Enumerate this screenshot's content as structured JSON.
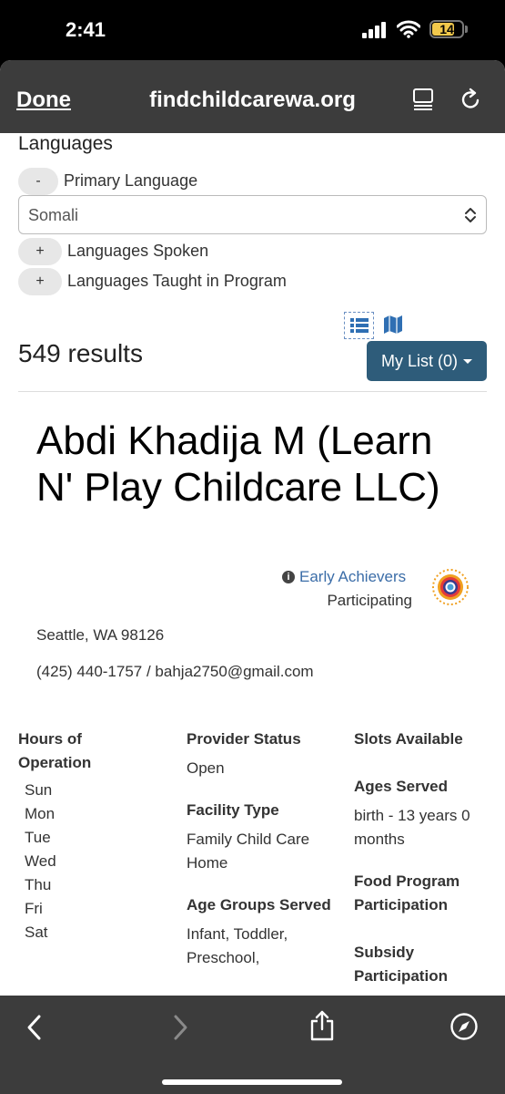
{
  "status_bar": {
    "time": "2:41",
    "battery": "14"
  },
  "browser": {
    "done_label": "Done",
    "domain": "findchildcarewa.org"
  },
  "languages": {
    "title": "Languages",
    "primary": {
      "toggle": "-",
      "label": "Primary Language",
      "selected": "Somali"
    },
    "spoken": {
      "toggle": "+",
      "label": "Languages Spoken"
    },
    "taught": {
      "toggle": "+",
      "label": "Languages Taught in Program"
    }
  },
  "results": {
    "count_text": "549 results",
    "my_list_label": "My List (0)"
  },
  "provider": {
    "name": "Abdi Khadija M (Learn N' Play Childcare LLC)",
    "early_achievers_label": "Early Achievers",
    "early_achievers_status": "Participating",
    "address": "Seattle, WA 98126",
    "contact": "(425) 440-1757 / bahja2750@gmail.com",
    "hours": {
      "heading": "Hours of Operation",
      "days": [
        "Sun",
        "Mon",
        "Tue",
        "Wed",
        "Thu",
        "Fri",
        "Sat"
      ]
    },
    "provider_status": {
      "heading": "Provider Status",
      "value": "Open"
    },
    "facility_type": {
      "heading": "Facility Type",
      "value": "Family Child Care Home"
    },
    "age_groups": {
      "heading": "Age Groups Served",
      "value": "Infant, Toddler, Preschool,"
    },
    "slots": {
      "heading": "Slots Available"
    },
    "ages_served": {
      "heading": "Ages Served",
      "value": "birth - 13 years 0 months"
    },
    "food_program": {
      "heading": "Food Program Participation"
    },
    "subsidy": {
      "heading": "Subsidy Participation"
    }
  },
  "colors": {
    "accent": "#2e5c7a",
    "link": "#3b6da8",
    "chrome": "#3c3c3c"
  }
}
